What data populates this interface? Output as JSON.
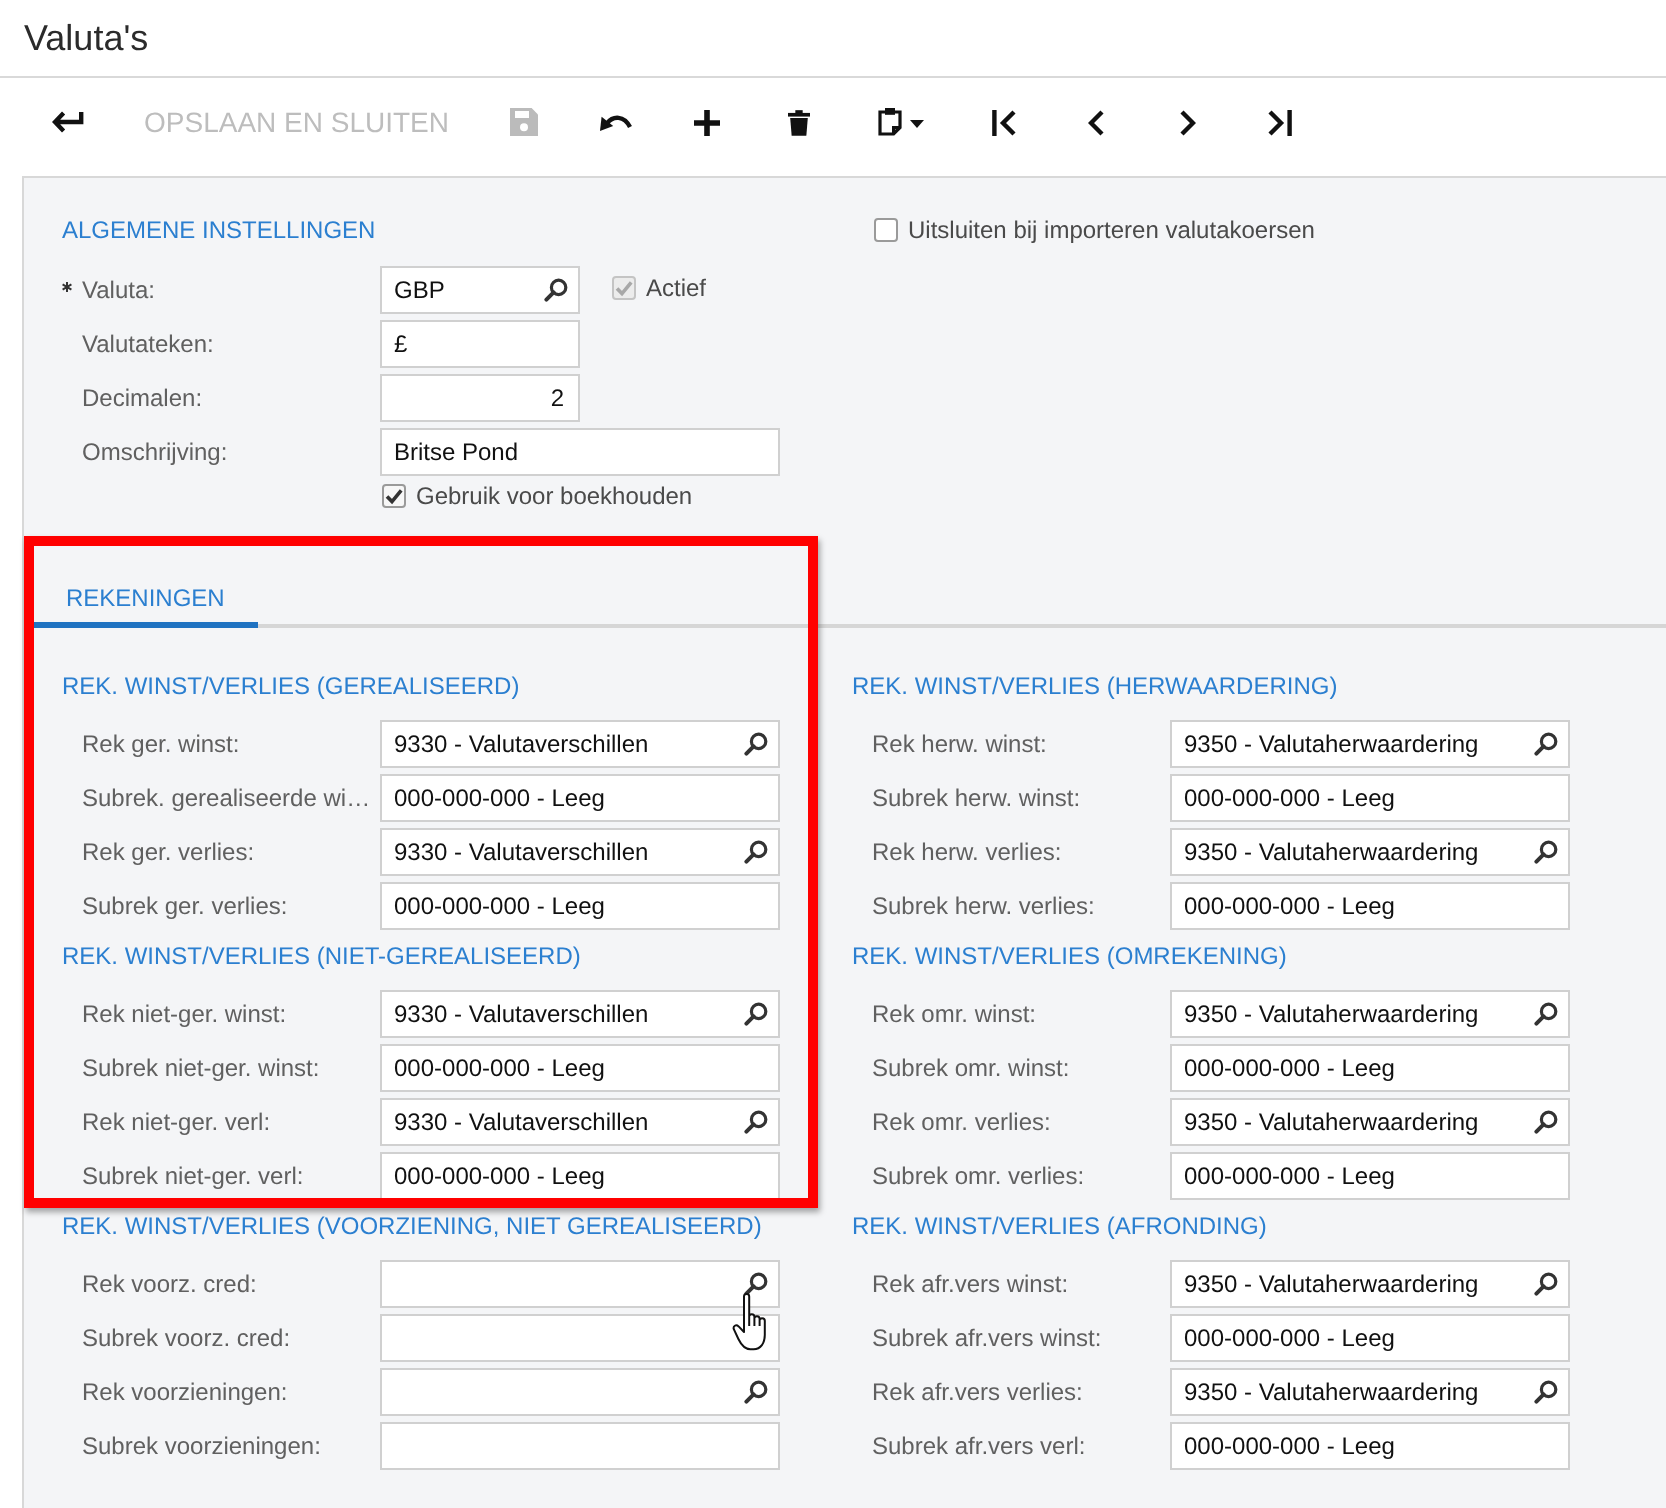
{
  "window": {
    "title": "Valuta's"
  },
  "toolbar": {
    "save_and_close": {
      "label": "OPSLAAN EN SLUITEN",
      "disabled": true
    },
    "save": {
      "disabled": true
    }
  },
  "general": {
    "title": "ALGEMENE INSTELLINGEN",
    "fields": [
      {
        "label": "Valuta:",
        "required": true,
        "kind": "lookup",
        "value": "GBP",
        "checkbox": {
          "label": "Actief",
          "checked": true,
          "disabled": true
        }
      },
      {
        "label": "Valutateken:",
        "required": false,
        "kind": "text",
        "value": "£"
      },
      {
        "label": "Decimalen:",
        "required": false,
        "kind": "number",
        "value": "2"
      },
      {
        "label": "Omschrijving:",
        "required": false,
        "kind": "wide",
        "value": "Britse Pond"
      }
    ],
    "use_for_accounting": {
      "label": "Gebruik voor boekhouden",
      "checked": true
    },
    "exclude_from_rate_import": {
      "label": "Uitsluiten bij importeren valutakoersen",
      "checked": false
    }
  },
  "tabs": [
    {
      "label": "REKENINGEN",
      "selected": true
    }
  ],
  "account_columns": [
    {
      "sections": [
        {
          "title": "REK. WINST/VERLIES (GEREALISEERD)",
          "fields": [
            {
              "label": "Rek ger. winst:",
              "kind": "lookup",
              "value": "9330 - Valutaverschillen"
            },
            {
              "label": "Subrek. gerealiseerde wi…",
              "kind": "text",
              "value": "000-000-000 - Leeg"
            },
            {
              "label": "Rek ger. verlies:",
              "kind": "lookup",
              "value": "9330 - Valutaverschillen"
            },
            {
              "label": "Subrek ger. verlies:",
              "kind": "text",
              "value": "000-000-000 - Leeg"
            }
          ]
        },
        {
          "title": "REK. WINST/VERLIES (NIET-GEREALISEERD)",
          "fields": [
            {
              "label": "Rek niet-ger. winst:",
              "kind": "lookup",
              "value": "9330 - Valutaverschillen"
            },
            {
              "label": "Subrek niet-ger. winst:",
              "kind": "text",
              "value": "000-000-000 - Leeg"
            },
            {
              "label": "Rek niet-ger. verl:",
              "kind": "lookup",
              "value": "9330 - Valutaverschillen"
            },
            {
              "label": "Subrek niet-ger. verl:",
              "kind": "text",
              "value": "000-000-000 - Leeg"
            }
          ]
        },
        {
          "title": "REK. WINST/VERLIES (VOORZIENING, NIET GEREALISEERD)",
          "fields": [
            {
              "label": "Rek voorz. cred:",
              "kind": "lookup"
            },
            {
              "label": "Subrek voorz. cred:",
              "kind": "text"
            },
            {
              "label": "Rek voorzieningen:",
              "kind": "lookup"
            },
            {
              "label": "Subrek voorzieningen:",
              "kind": "text"
            }
          ]
        }
      ]
    },
    {
      "sections": [
        {
          "title": "REK. WINST/VERLIES (HERWAARDERING)",
          "fields": [
            {
              "label": "Rek herw. winst:",
              "kind": "lookup",
              "value": "9350 - Valutaherwaardering"
            },
            {
              "label": "Subrek herw. winst:",
              "kind": "text",
              "value": "000-000-000 - Leeg"
            },
            {
              "label": "Rek herw. verlies:",
              "kind": "lookup",
              "value": "9350 - Valutaherwaardering"
            },
            {
              "label": "Subrek herw. verlies:",
              "kind": "text",
              "value": "000-000-000 - Leeg"
            }
          ]
        },
        {
          "title": "REK. WINST/VERLIES (OMREKENING)",
          "fields": [
            {
              "label": "Rek omr. winst:",
              "kind": "lookup",
              "value": "9350 - Valutaherwaardering"
            },
            {
              "label": "Subrek omr. winst:",
              "kind": "text",
              "value": "000-000-000 - Leeg"
            },
            {
              "label": "Rek omr. verlies:",
              "kind": "lookup",
              "value": "9350 - Valutaherwaardering"
            },
            {
              "label": "Subrek omr. verlies:",
              "kind": "text",
              "value": "000-000-000 - Leeg"
            }
          ]
        },
        {
          "title": "REK. WINST/VERLIES (AFRONDING)",
          "fields": [
            {
              "label": "Rek afr.vers winst:",
              "kind": "lookup",
              "value": "9350 - Valutaherwaardering"
            },
            {
              "label": "Subrek afr.vers winst:",
              "kind": "text",
              "value": "000-000-000 - Leeg"
            },
            {
              "label": "Rek afr.vers verlies:",
              "kind": "lookup",
              "value": "9350 - Valutaherwaardering"
            },
            {
              "label": "Subrek afr.vers verl:",
              "kind": "text",
              "value": "000-000-000 - Leeg"
            }
          ]
        }
      ]
    }
  ]
}
